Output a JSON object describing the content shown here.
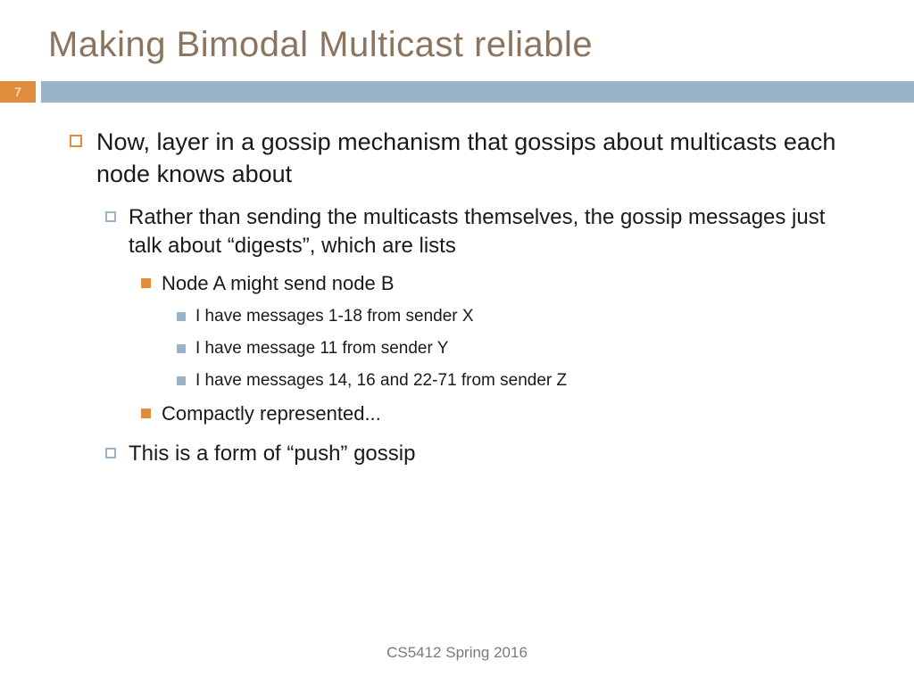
{
  "title": "Making Bimodal Multicast reliable",
  "slide_number": "7",
  "bullets": {
    "b1": "Now, layer in a gossip mechanism that gossips about multicasts each node knows about",
    "b2": "Rather than sending the multicasts themselves, the gossip messages just talk about “digests”, which are lists",
    "b3": "Node A might send node B",
    "b4": "I have messages 1-18 from sender X",
    "b5": "I have message 11 from sender Y",
    "b6": "I have messages 14, 16 and 22-71 from sender Z",
    "b7": "Compactly represented...",
    "b8": "This is a form of “push” gossip"
  },
  "footer": "CS5412 Spring 2016"
}
